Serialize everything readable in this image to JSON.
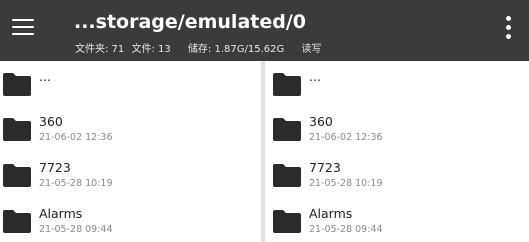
{
  "toolbar": {
    "title": "...storage/emulated/0",
    "folders_label": "文件夹: 71",
    "files_label": "文件: 13",
    "storage_label": "储存: 1.87G/15.62G",
    "mode_label": "读写",
    "menu_icon": "hamburger-menu-icon",
    "overflow_icon": "more-vert-icon"
  },
  "left_pane": {
    "items": [
      {
        "name": "...",
        "date": ""
      },
      {
        "name": "360",
        "date": "21-06-02 12:36"
      },
      {
        "name": "7723",
        "date": "21-05-28 10:19"
      },
      {
        "name": "Alarms",
        "date": "21-05-28 09:44"
      }
    ]
  },
  "right_pane": {
    "items": [
      {
        "name": "...",
        "date": ""
      },
      {
        "name": "360",
        "date": "21-06-02 12:36"
      },
      {
        "name": "7723",
        "date": "21-05-28 10:19"
      },
      {
        "name": "Alarms",
        "date": "21-05-28 09:44"
      }
    ]
  },
  "colors": {
    "toolbar_bg": "#3b3b3b",
    "folder_icon": "#2b2b2b",
    "divider": "#e2e2e2"
  }
}
